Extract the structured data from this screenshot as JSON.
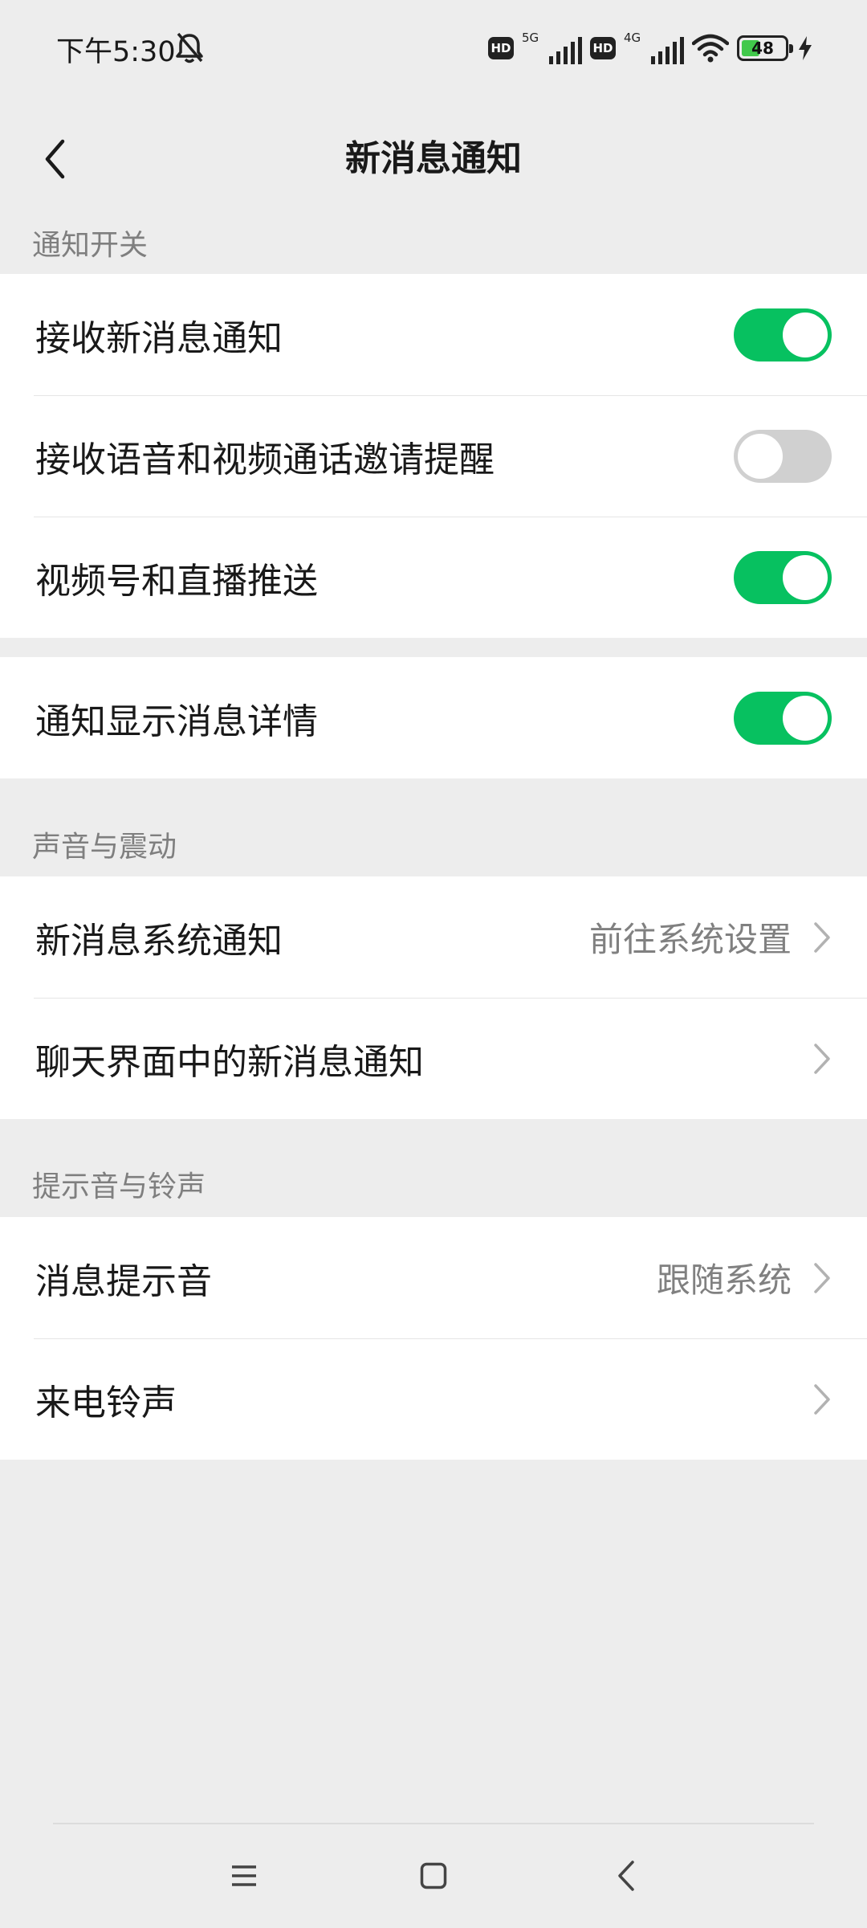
{
  "status_bar": {
    "time": "下午5:30",
    "hd1": "HD",
    "net1": "5G",
    "hd2": "HD",
    "net2": "4G",
    "battery": "48",
    "battery_level_percent": 48,
    "battery_color": "#41c94b"
  },
  "nav": {
    "title": "新消息通知"
  },
  "colors": {
    "toggle_on": "#07c160",
    "toggle_off": "#d0d0d0",
    "background": "#ededed"
  },
  "sections": {
    "notify_switch": {
      "header": "通知开关",
      "items": [
        {
          "label": "接收新消息通知",
          "enabled": true
        },
        {
          "label": "接收语音和视频通话邀请提醒",
          "enabled": false
        },
        {
          "label": "视频号和直播推送",
          "enabled": true
        }
      ]
    },
    "detail": {
      "items": [
        {
          "label": "通知显示消息详情",
          "enabled": true
        }
      ]
    },
    "sound_vibration": {
      "header": "声音与震动",
      "items": [
        {
          "label": "新消息系统通知",
          "value": "前往系统设置"
        },
        {
          "label": "聊天界面中的新消息通知",
          "value": ""
        }
      ]
    },
    "tones": {
      "header": "提示音与铃声",
      "items": [
        {
          "label": "消息提示音",
          "value": "跟随系统"
        },
        {
          "label": "来电铃声",
          "value": ""
        }
      ]
    }
  },
  "system_nav": {
    "icons": [
      "menu-icon",
      "home-icon",
      "back-icon"
    ]
  }
}
